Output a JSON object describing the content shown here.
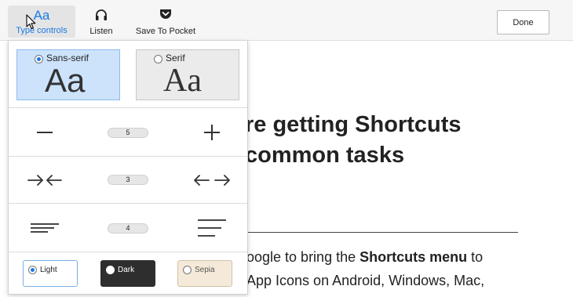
{
  "toolbar": {
    "type_controls": {
      "glyph": "Aa",
      "label": "Type controls",
      "icon": "type-aa-icon"
    },
    "listen": {
      "label": "Listen",
      "icon": "headphones-icon"
    },
    "pocket": {
      "label": "Save To Pocket",
      "icon": "pocket-icon"
    },
    "done_label": "Done"
  },
  "colors": {
    "accent": "#1a7be6",
    "selected_bg": "#cce3fb",
    "dark_theme": "#2e2e2e",
    "sepia_theme": "#f5ead9"
  },
  "type_panel": {
    "fonts": [
      {
        "name": "Sans-serif",
        "sample": "Aa",
        "selected": true
      },
      {
        "name": "Serif",
        "sample": "Aa",
        "selected": false
      }
    ],
    "font_size": {
      "value": "5",
      "decrease_icon": "minus-icon",
      "increase_icon": "plus-icon"
    },
    "content_width": {
      "value": "3",
      "narrow_icon": "arrows-inward-icon",
      "wide_icon": "arrows-outward-icon"
    },
    "line_height": {
      "value": "4",
      "tighter_icon": "lines-tight-icon",
      "looser_icon": "lines-loose-icon"
    },
    "themes": [
      {
        "name": "Light",
        "selected": true
      },
      {
        "name": "Dark",
        "selected": false
      },
      {
        "name": "Sepia",
        "selected": false
      }
    ]
  },
  "article": {
    "heading_line1": "re getting Shortcuts",
    "heading_line2": "common tasks",
    "p_line1_a": "oogle to bring the ",
    "p_line1_b": "Shortcuts menu",
    "p_line1_c": " to",
    "p_line2": "App Icons on Android, Windows, Mac,"
  }
}
